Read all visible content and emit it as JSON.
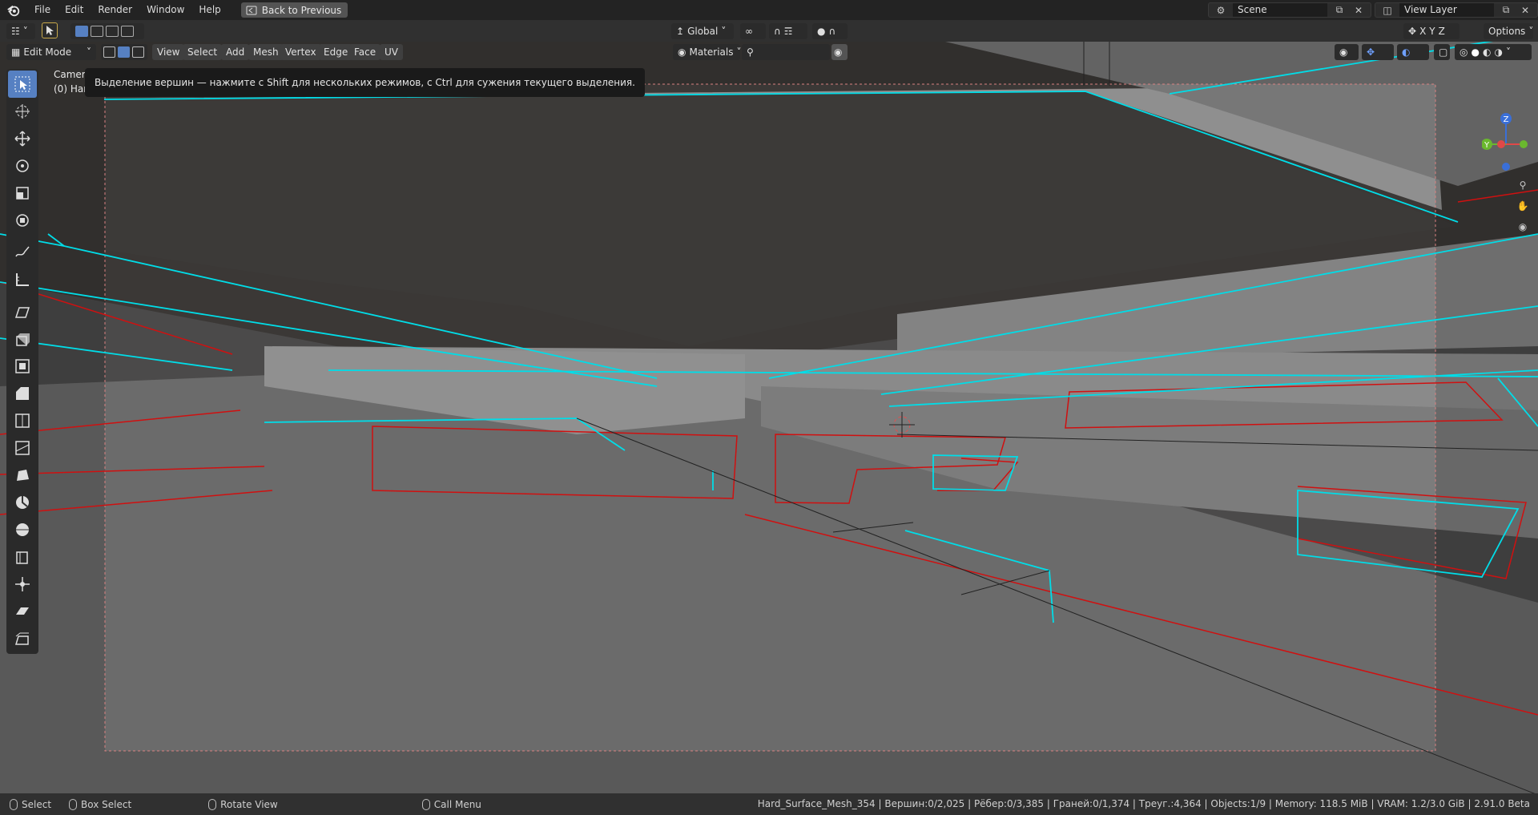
{
  "topbar": {
    "menus": [
      "File",
      "Edit",
      "Render",
      "Window",
      "Help"
    ],
    "back_label": "Back to Previous",
    "scene_label": "Scene",
    "view_layer_label": "View Layer"
  },
  "header": {
    "transform_orientation": "Global",
    "options_label": "Options",
    "mode": "Edit Mode",
    "menus": [
      "View",
      "Select",
      "Add",
      "Mesh",
      "Vertex",
      "Edge",
      "Face",
      "UV"
    ],
    "material_filter": "Materials",
    "axis_x": "X",
    "axis_y": "Y",
    "axis_z": "Z"
  },
  "viewport": {
    "camera_label": "Camera",
    "object_label": "(0) Har",
    "tooltip": "Выделение вершин — нажмите с Shift для нескольких режимов, с Ctrl для сужения текущего выделения.",
    "gizmo_z": "Z",
    "gizmo_y": "Y"
  },
  "toolbar_icons": [
    "select-box-icon",
    "cursor-icon",
    "move-icon",
    "rotate-icon",
    "scale-icon",
    "transform-icon",
    "annotate-icon",
    "measure-icon",
    "add-cube-icon",
    "extrude-icon",
    "inset-icon",
    "bevel-icon",
    "loop-cut-icon",
    "knife-icon",
    "poly-build-icon",
    "spin-icon",
    "smooth-icon",
    "edge-slide-icon",
    "shrink-icon",
    "shear-icon",
    "rip-icon"
  ],
  "statusbar": {
    "select_label": "Select",
    "box_select_label": "Box Select",
    "rotate_view_label": "Rotate View",
    "call_menu_label": "Call Menu",
    "stats": "Hard_Surface_Mesh_354 | Вершин:0/2,025 | Рёбер:0/3,385 | Граней:0/1,374 | Треуг.:4,364 | Objects:1/9 | Memory: 118.5 MiB | VRAM: 1.2/3.0 GiB | 2.91.0 Beta"
  },
  "colors": {
    "accent": "#5680c2",
    "edge_selected": "#00e5ff",
    "edge_seam": "#d01010",
    "frame": "#e04040"
  }
}
